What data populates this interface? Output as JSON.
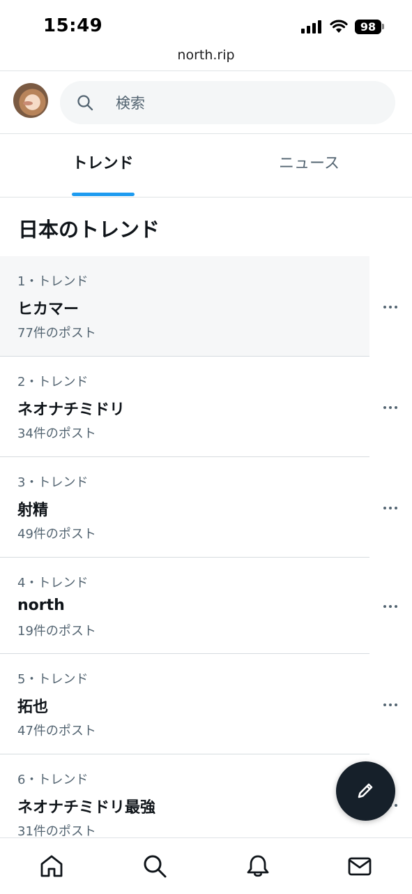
{
  "status_bar": {
    "time": "15:49",
    "battery": "98"
  },
  "browser": {
    "url": "north.rip"
  },
  "search": {
    "placeholder": "検索"
  },
  "tabs": [
    {
      "label": "トレンド",
      "active": true
    },
    {
      "label": "ニュース",
      "active": false
    }
  ],
  "section_title": "日本のトレンド",
  "trends": [
    {
      "rank": "1・トレンド",
      "name": "ヒカマー",
      "count": "77件のポスト"
    },
    {
      "rank": "2・トレンド",
      "name": "ネオナチミドリ",
      "count": "34件のポスト"
    },
    {
      "rank": "3・トレンド",
      "name": "射精",
      "count": "49件のポスト"
    },
    {
      "rank": "4・トレンド",
      "name": "north",
      "count": "19件のポスト"
    },
    {
      "rank": "5・トレンド",
      "name": "拓也",
      "count": "47件のポスト"
    },
    {
      "rank": "6・トレンド",
      "name": "ネオナチミドリ最強",
      "count": "31件のポスト"
    }
  ],
  "colors": {
    "accent": "#1d9bf0",
    "fab": "#16202a",
    "secondary_text": "#536471"
  },
  "icons": {
    "nav": [
      "home-icon",
      "search-icon",
      "bell-icon",
      "mail-icon"
    ],
    "fab": "pencil-icon",
    "row_menu": "more-icon"
  }
}
